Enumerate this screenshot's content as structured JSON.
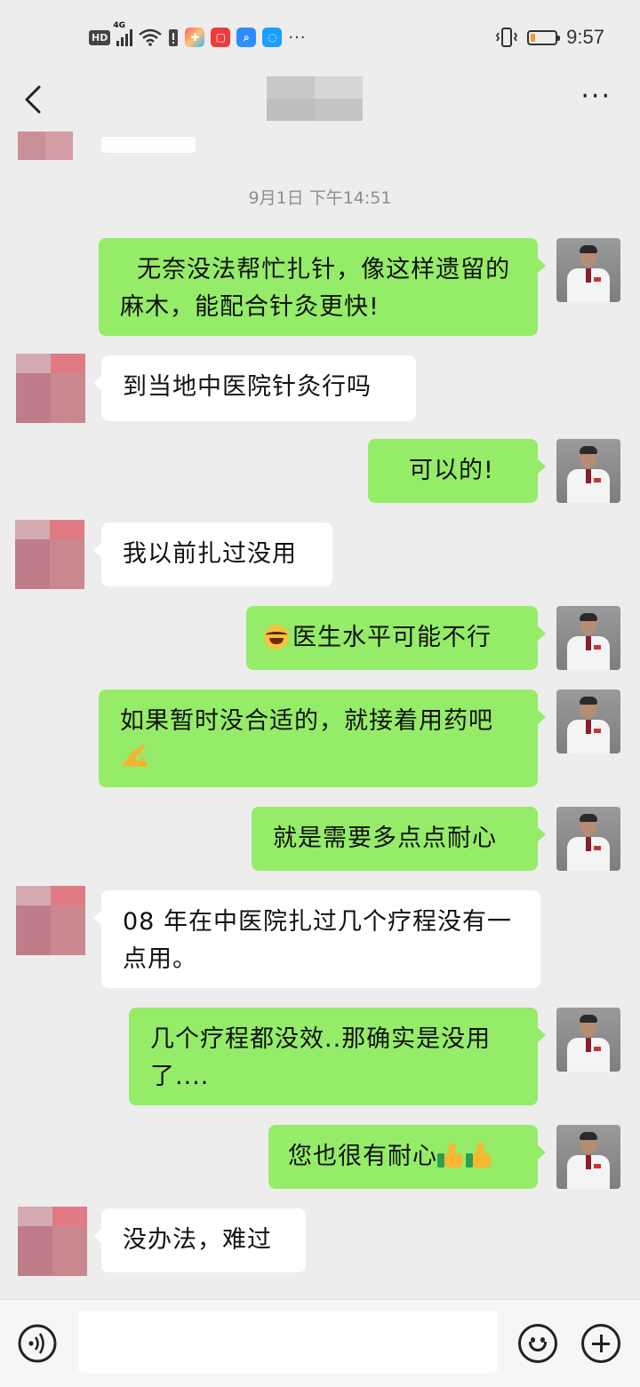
{
  "status_bar": {
    "hd_label": "HD",
    "network_label": "4G",
    "time": "9:57",
    "battery_level": 0.2,
    "more_icons": "···",
    "app_icons": [
      "app-icon-colorful",
      "app-icon-red",
      "app-icon-search",
      "app-icon-bulb"
    ]
  },
  "header": {
    "back_icon": "chevron-left-icon",
    "more_icon": "more-dots-icon",
    "more_label": "···"
  },
  "chat": {
    "timestamp": "9月1日 下午14:51",
    "messages": [
      {
        "side": "right",
        "text": "  无奈没法帮忙扎针，像这样遗留的麻木，能配合针灸更快!"
      },
      {
        "side": "left",
        "text": "到当地中医院针灸行吗"
      },
      {
        "side": "right",
        "text": "可以的!"
      },
      {
        "side": "left",
        "text": "我以前扎过没用"
      },
      {
        "side": "right",
        "text": "医生水平可能不行",
        "emoji_before": "laughing-crying-emoji"
      },
      {
        "side": "right",
        "text": "如果暂时没合适的，就接着用药吧",
        "emoji_after": "ok-hand-emoji"
      },
      {
        "side": "right",
        "text": "就是需要多点点耐心"
      },
      {
        "side": "left",
        "text": "08 年在中医院扎过几个疗程没有一点用。"
      },
      {
        "side": "right",
        "text": "几个疗程都没效..那确实是没用了...."
      },
      {
        "side": "right",
        "text": "您也很有耐心",
        "emoji_after": "thumbs-up-emoji x2"
      },
      {
        "side": "left",
        "text": "没办法，难过"
      }
    ]
  },
  "input_bar": {
    "voice_icon": "voice-icon",
    "emoji_icon": "emoji-icon",
    "plus_icon": "plus-icon",
    "input_value": ""
  },
  "colors": {
    "background": "#ededed",
    "outgoing_bubble": "#95ec69",
    "incoming_bubble": "#ffffff",
    "timestamp_text": "#8e8e8e"
  }
}
